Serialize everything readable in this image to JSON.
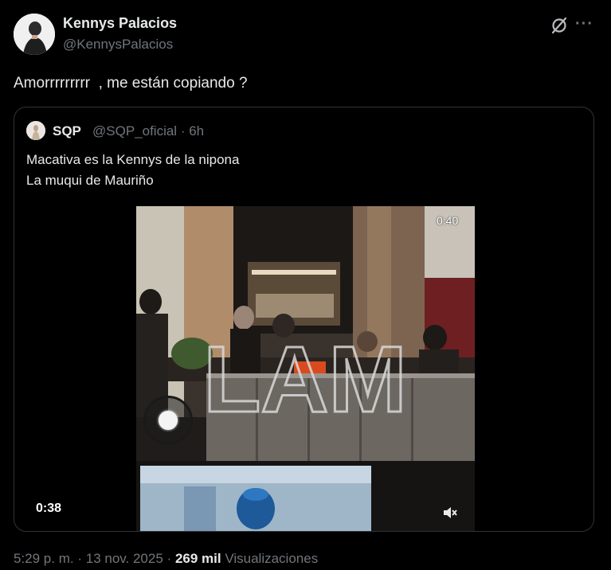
{
  "post": {
    "author_name": "Kennys Palacios",
    "author_handle": "@KennysPalacios",
    "text": "Amorrrrrrrrr  , me están copiando ?",
    "grok_icon": "grok-icon",
    "more_icon": "more-icon",
    "more_label": "···"
  },
  "quote": {
    "name": "SQP",
    "handle": "@SQP_oficial",
    "separator": "·",
    "time": "6h",
    "line1": "Macativa es la Kennys de la nipona",
    "line2": "La muqui de Mauriño",
    "video": {
      "duration_top": "0:40",
      "duration_bottom": "0:38",
      "watermark": "LAM",
      "mute_icon": "volume-muted-icon"
    }
  },
  "footer": {
    "time": "5:29 p. m.",
    "separator": "·",
    "date": "13 nov. 2025",
    "views_count": "269 mil",
    "views_label": "Visualizaciones"
  },
  "colors": {
    "background": "#000000",
    "primary_text": "#e7e9ea",
    "secondary_text": "#71767b",
    "border": "#2f3336"
  }
}
